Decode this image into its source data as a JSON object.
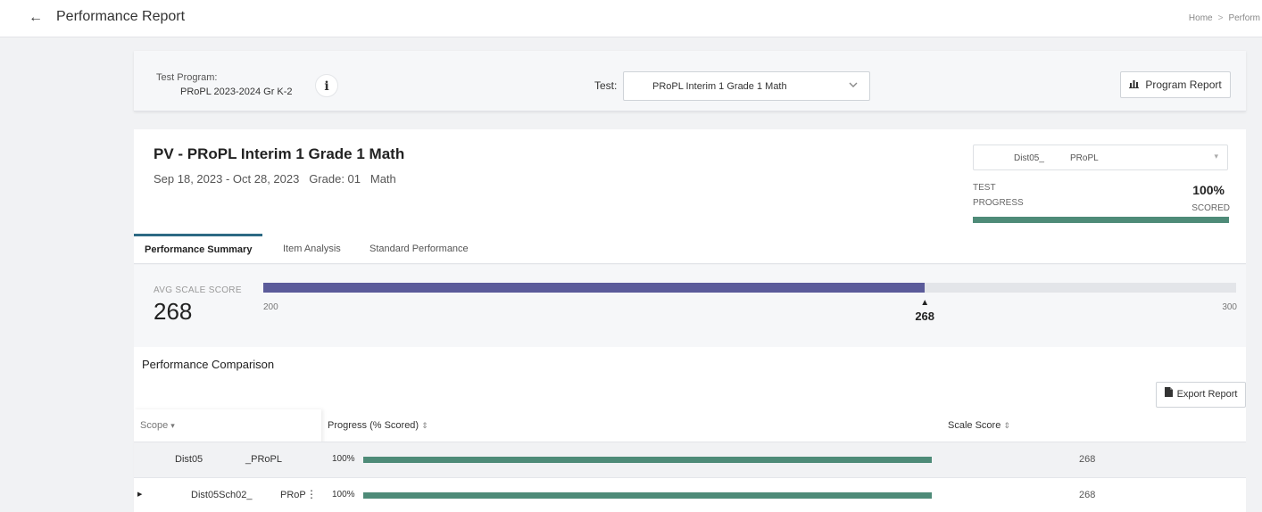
{
  "header": {
    "title": "Performance Report",
    "breadcrumb": [
      "Home",
      "Perform"
    ]
  },
  "program": {
    "label": "Test Program:",
    "value": "PRoPL 2023-2024 Gr K-2",
    "test_label": "Test:",
    "test_value": "PRoPL Interim 1 Grade 1 Math",
    "report_button": "Program Report"
  },
  "report": {
    "title": "PV - PRoPL Interim 1 Grade 1 Math",
    "dates": "Sep 18, 2023 - Oct 28, 2023",
    "grade": "Grade: 01",
    "subject": "Math",
    "scope_select": [
      "Dist05_",
      "PRoPL"
    ],
    "progress_label_1": "TEST",
    "progress_label_2": "PROGRESS",
    "progress_pct": "100%",
    "progress_scored": "SCORED",
    "progress_value": 100
  },
  "tabs": [
    {
      "label": "Performance Summary",
      "active": true
    },
    {
      "label": "Item Analysis",
      "active": false
    },
    {
      "label": "Standard Performance",
      "active": false
    }
  ],
  "avg_score": {
    "label": "AVG SCALE SCORE",
    "value": "268",
    "min": "200",
    "max": "300",
    "score": 268,
    "range": [
      200,
      300
    ]
  },
  "comparison": {
    "title": "Performance Comparison",
    "export_button": "Export Report",
    "columns": {
      "scope": "Scope",
      "progress": "Progress (% Scored)",
      "scale": "Scale Score"
    },
    "rows": [
      {
        "name1": "Dist05",
        "name2": "_PRoPL",
        "pct": "100%",
        "progress": 100,
        "scale": "268"
      },
      {
        "name1": "Dist05Sch02_",
        "name2": "PRoP",
        "pct": "100%",
        "progress": 100,
        "scale": "268"
      }
    ]
  },
  "colors": {
    "score_fill": "#5b5b9a",
    "progress_fill": "#4e8b78",
    "tab_accent": "#2d6a84"
  },
  "icons": {
    "back": "←",
    "info": "i",
    "chevron": "⌄",
    "chart": "📊",
    "file": "📄",
    "sort": "⇕",
    "caret_down": "▾",
    "expand": "▶",
    "kebab": "⋮",
    "marker": "▲"
  }
}
